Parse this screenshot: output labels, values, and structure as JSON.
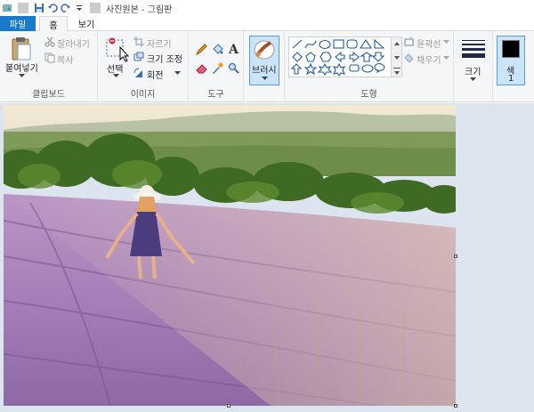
{
  "window": {
    "title": "사진원본 - 그림판"
  },
  "tabs": [
    {
      "label": "파일"
    },
    {
      "label": "홈"
    },
    {
      "label": "보기"
    }
  ],
  "clipboard": {
    "paste_label": "붙여넣기",
    "cut_label": "잘라내기",
    "copy_label": "복사",
    "group_label": "클립보드"
  },
  "image": {
    "select_label": "선택",
    "crop_label": "자르기",
    "resize_label": "크기 조정",
    "rotate_label": "회전",
    "group_label": "이미지"
  },
  "tools": {
    "group_label": "도구"
  },
  "brushes": {
    "label": "브러시"
  },
  "shapes": {
    "outline_label": "윤곽선",
    "fill_label": "채우기",
    "group_label": "도형"
  },
  "size": {
    "label": "크기"
  },
  "color": {
    "label": "색",
    "index": "1",
    "value": "#000000"
  },
  "colors": {
    "accent": "#1979ca",
    "ribbon_bg": "#f5f6f7",
    "workspace": "#dbe4ef"
  }
}
